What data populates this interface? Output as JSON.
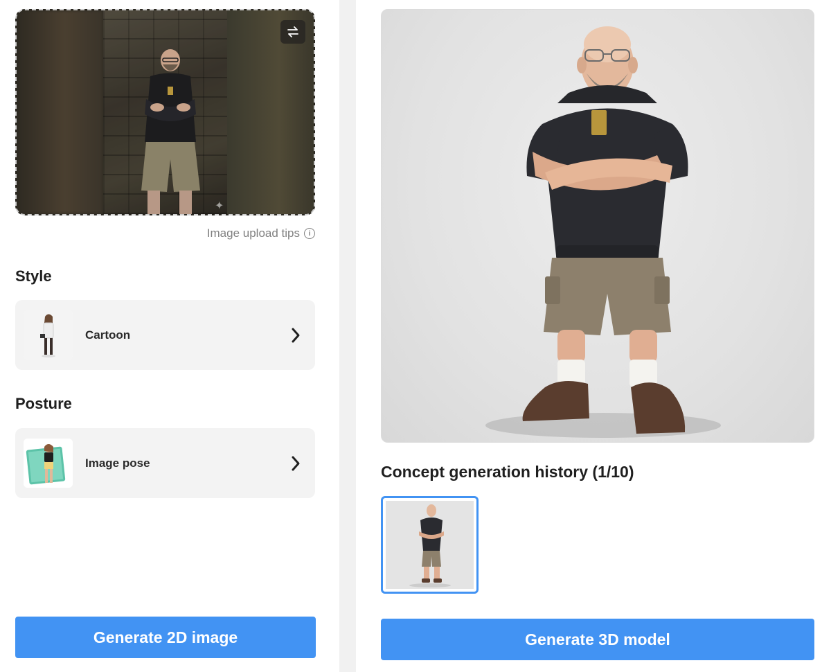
{
  "left_panel": {
    "upload": {
      "swap_icon": "swap-arrows-icon",
      "tips_label": "Image upload tips",
      "tips_icon": "info-icon"
    },
    "style": {
      "title": "Style",
      "selected_label": "Cartoon"
    },
    "posture": {
      "title": "Posture",
      "selected_label": "Image pose"
    },
    "generate_button": "Generate 2D image"
  },
  "right_panel": {
    "history_title": "Concept generation history (1/10)",
    "generate_button": "Generate 3D model"
  },
  "colors": {
    "accent": "#4293f3",
    "card_bg": "#f3f3f3",
    "divider": "#f1f1f1"
  }
}
